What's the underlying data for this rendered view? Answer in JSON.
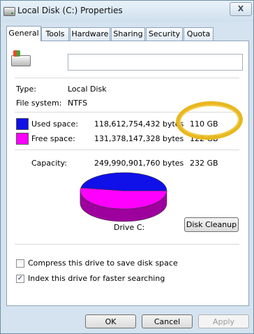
{
  "window": {
    "title": "Local Disk (C:) Properties",
    "close_label": "X"
  },
  "tabs": [
    {
      "label": "General",
      "active": true
    },
    {
      "label": "Tools",
      "active": false
    },
    {
      "label": "Hardware",
      "active": false
    },
    {
      "label": "Sharing",
      "active": false
    },
    {
      "label": "Security",
      "active": false
    },
    {
      "label": "Quota",
      "active": false
    }
  ],
  "general": {
    "volume_name_value": "",
    "type_label": "Type:",
    "type_value": "Local Disk",
    "filesystem_label": "File system:",
    "filesystem_value": "NTFS",
    "used_label": "Used space:",
    "used_bytes": "118,612,754,432 bytes",
    "used_size": "110 GB",
    "free_label": "Free space:",
    "free_bytes": "131,378,147,328 bytes",
    "free_size": "122 GB",
    "capacity_label": "Capacity:",
    "capacity_bytes": "249,990,901,760 bytes",
    "capacity_size": "232 GB",
    "drive_label": "Drive C:",
    "cleanup_button": "Disk Cleanup",
    "compress_label": "Compress this drive to save disk space",
    "compress_checked": false,
    "index_label": "Index this drive for faster searching",
    "index_checked": true
  },
  "usage": {
    "used_fraction": 0.474,
    "used_color": "#1010e8",
    "free_color": "#ff00ff"
  },
  "buttons": {
    "ok": "OK",
    "cancel": "Cancel",
    "apply": "Apply"
  },
  "icons": {
    "title": "drive-icon",
    "drive": "drive-icon"
  }
}
